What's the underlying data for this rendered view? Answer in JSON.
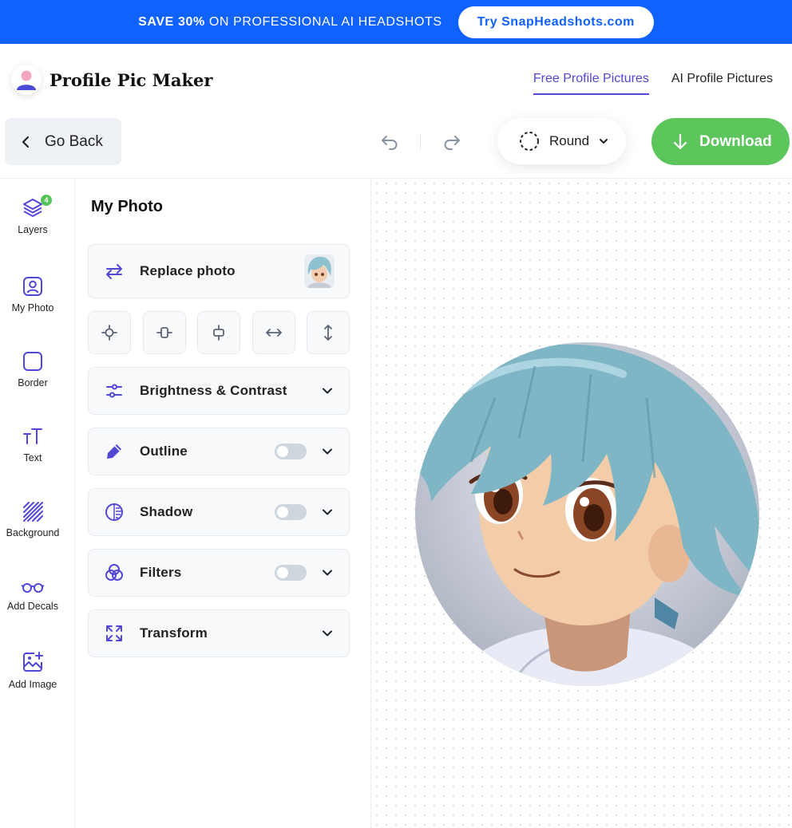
{
  "promo": {
    "strong": "SAVE 30%",
    "rest": " ON PROFESSIONAL AI HEADSHOTS",
    "cta": "Try SnapHeadshots.com"
  },
  "header": {
    "title": "Profile Pic Maker",
    "nav": [
      {
        "label": "Free Profile Pictures",
        "active": true
      },
      {
        "label": "AI Profile Pictures",
        "active": false
      }
    ]
  },
  "toolbar": {
    "back": "Go Back",
    "shape": "Round",
    "download": "Download"
  },
  "rail": {
    "items": [
      {
        "label": "Layers",
        "icon": "layers-icon",
        "badge": "4"
      },
      {
        "label": "My Photo",
        "icon": "user-square-icon"
      },
      {
        "label": "Border",
        "icon": "border-square-icon"
      },
      {
        "label": "Text",
        "icon": "text-icon"
      },
      {
        "label": "Background",
        "icon": "hatched-square-icon"
      },
      {
        "label": "Add Decals",
        "icon": "glasses-icon"
      },
      {
        "label": "Add Image",
        "icon": "image-plus-icon"
      }
    ]
  },
  "panel": {
    "title": "My Photo",
    "replace": "Replace photo",
    "align_buttons": [
      "center-icon",
      "align-vertical-center-icon",
      "align-horizontal-center-icon",
      "stretch-horizontal-icon",
      "stretch-vertical-icon"
    ],
    "sections": [
      {
        "label": "Brightness & Contrast",
        "toggle": false
      },
      {
        "label": "Outline",
        "toggle": true,
        "on": false
      },
      {
        "label": "Shadow",
        "toggle": true,
        "on": false
      },
      {
        "label": "Filters",
        "toggle": true,
        "on": false
      },
      {
        "label": "Transform",
        "toggle": false
      }
    ]
  },
  "colors": {
    "brand_blue": "#1062fe",
    "accent_purple": "#5147d6",
    "download_green": "#5cc65d"
  }
}
